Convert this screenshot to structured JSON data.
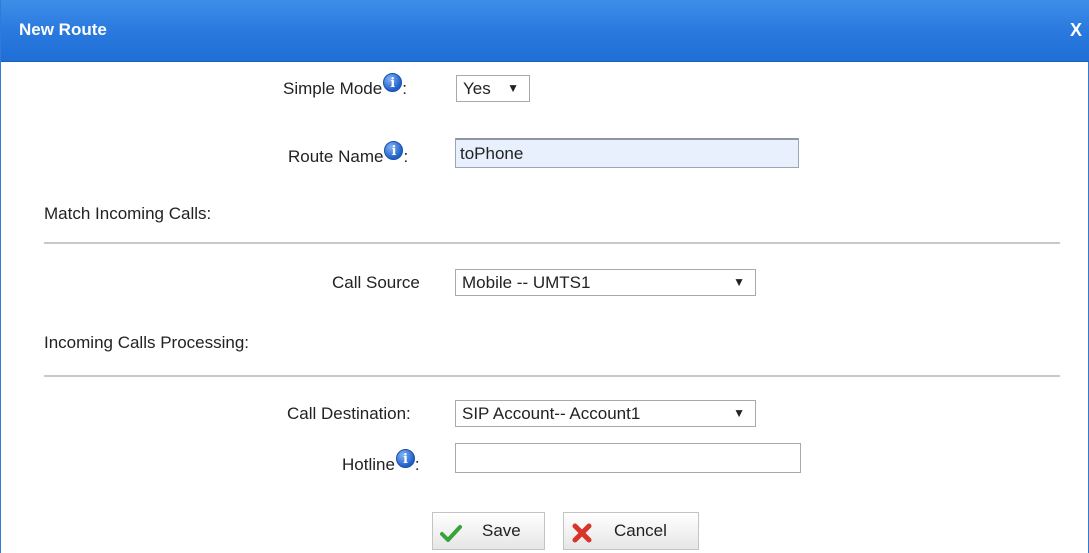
{
  "dialog": {
    "title": "New Route",
    "close_label": "X"
  },
  "form": {
    "simple_mode": {
      "label": "Simple Mode",
      "value": "Yes"
    },
    "route_name": {
      "label": "Route Name",
      "value": "toPhone"
    },
    "match_section": "Match Incoming Calls:",
    "call_source": {
      "label": "Call Source",
      "value": "Mobile -- UMTS1"
    },
    "processing_section": "Incoming Calls Processing:",
    "call_destination": {
      "label": "Call Destination:",
      "value": "SIP Account-- Account1"
    },
    "hotline": {
      "label": "Hotline",
      "value": ""
    },
    "colon": ":",
    "info_glyph": "i"
  },
  "buttons": {
    "save_label": "Save",
    "cancel_label": "Cancel"
  },
  "icons": {
    "info": "info-icon",
    "dropdown": "triangle-down-icon",
    "save": "check-icon",
    "cancel": "x-mark-icon"
  },
  "colors": {
    "title_bar": "#2878de",
    "check": "#3aa23a",
    "cancel": "#d9342b"
  }
}
